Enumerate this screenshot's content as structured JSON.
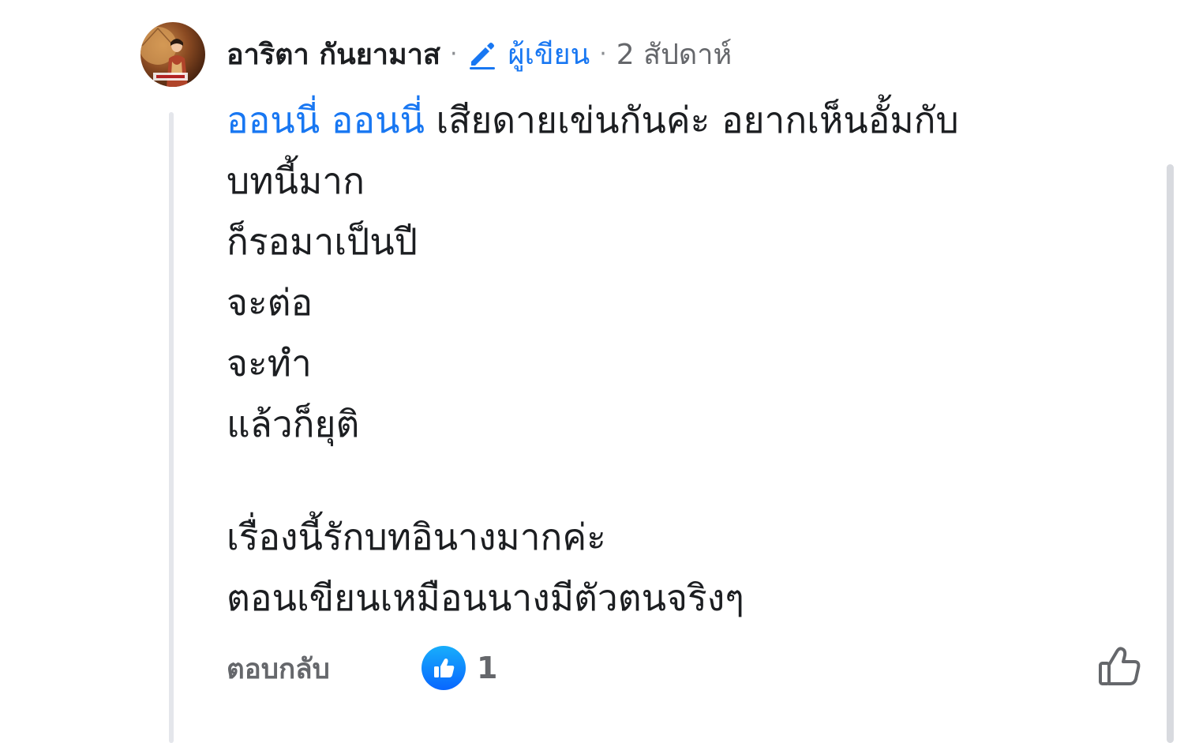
{
  "comment": {
    "author": "อาริตา กันยามาส",
    "separator": "·",
    "author_badge": "ผู้เขียน",
    "time": "2 สัปดาห์",
    "mention": "ออนนี่ ออนนี่",
    "first_line_rest": " เสียดายเข่นกันค่ะ  อยากเห็นอั้มกับ",
    "lines": [
      "บทนี้มาก",
      "ก็รอมาเป็นปี",
      "จะต่อ",
      "จะทำ",
      "แล้วก็ยุติ"
    ],
    "paragraph2": [
      "เรื่องนี้รักบทอินางมากค่ะ",
      "ตอนเขียนเหมือนนางมีตัวตนจริงๆ"
    ],
    "reply_label": "ตอบกลับ",
    "reaction_count": "1",
    "colors": {
      "accent": "#1877f2",
      "secondary_text": "#65676b",
      "thread_line": "#e4e6eb"
    },
    "icons": [
      "avatar-photo",
      "pencil-icon",
      "like-reaction-icon",
      "thumbs-up-outline-icon"
    ]
  }
}
